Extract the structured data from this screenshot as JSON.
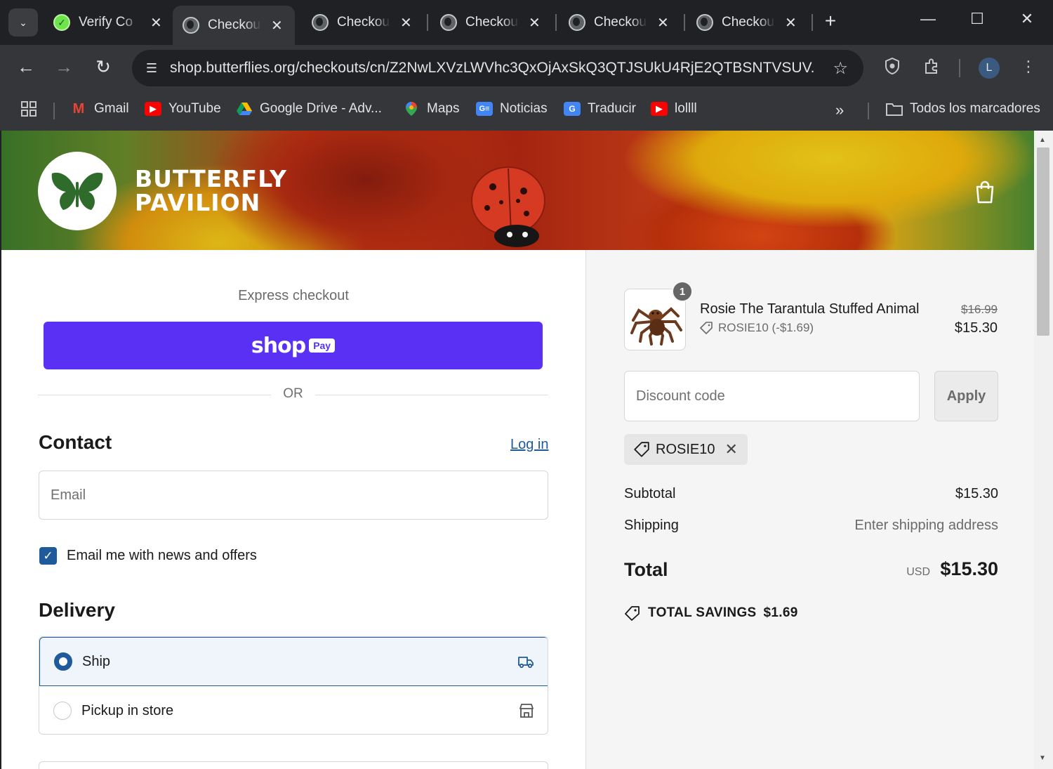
{
  "browser": {
    "tabs": [
      {
        "title": "Verify Co",
        "icon": "verify-check-icon",
        "active": false
      },
      {
        "title": "Checkout",
        "icon": "globe-icon",
        "active": true
      },
      {
        "title": "Checkout",
        "icon": "globe-icon",
        "active": false
      },
      {
        "title": "Checkout",
        "icon": "globe-icon",
        "active": false
      },
      {
        "title": "Checkout",
        "icon": "globe-icon",
        "active": false
      },
      {
        "title": "Checkout",
        "icon": "globe-icon",
        "active": false
      }
    ],
    "url": "shop.butterflies.org/checkouts/cn/Z2NwLXVzLWVhc3QxOjAxSkQ3QTJSUkU4RjE2QTBSNTVSUV...",
    "profile_initial": "L",
    "bookmarks": [
      {
        "label": "Gmail",
        "icon": "gmail-icon"
      },
      {
        "label": "YouTube",
        "icon": "youtube-icon"
      },
      {
        "label": "Google Drive - Adv...",
        "icon": "google-drive-icon"
      },
      {
        "label": "Maps",
        "icon": "maps-icon"
      },
      {
        "label": "Noticias",
        "icon": "news-icon"
      },
      {
        "label": "Traducir",
        "icon": "translate-icon"
      },
      {
        "label": "lollll",
        "icon": "youtube-icon"
      }
    ],
    "all_bookmarks_label": "Todos los marcadores"
  },
  "header": {
    "brand_line1": "BUTTERFLY",
    "brand_line2": "PAVILION"
  },
  "checkout": {
    "express_title": "Express checkout",
    "shop_pay_word": "shop",
    "shop_pay_badge": "Pay",
    "or_label": "OR",
    "contact_heading": "Contact",
    "login_label": "Log in",
    "email_placeholder": "Email",
    "newsletter_label": "Email me with news and offers",
    "newsletter_checked": true,
    "delivery_heading": "Delivery",
    "delivery_options": [
      {
        "label": "Ship",
        "selected": true,
        "icon": "truck-icon"
      },
      {
        "label": "Pickup in store",
        "selected": false,
        "icon": "store-icon"
      }
    ]
  },
  "summary": {
    "item": {
      "quantity": "1",
      "name": "Rosie The Tarantula Stuffed Animal",
      "discount_line": "ROSIE10 (-$1.69)",
      "original_price": "$16.99",
      "price": "$15.30"
    },
    "discount_placeholder": "Discount code",
    "apply_label": "Apply",
    "applied_code": "ROSIE10",
    "subtotal_label": "Subtotal",
    "subtotal_value": "$15.30",
    "shipping_label": "Shipping",
    "shipping_value": "Enter shipping address",
    "total_label": "Total",
    "currency": "USD",
    "total_value": "$15.30",
    "savings_label": "TOTAL SAVINGS",
    "savings_value": "$1.69"
  },
  "colors": {
    "shop_pay": "#5a31f4",
    "accent": "#1f5a9a",
    "summary_bg": "#f5f5f5"
  }
}
